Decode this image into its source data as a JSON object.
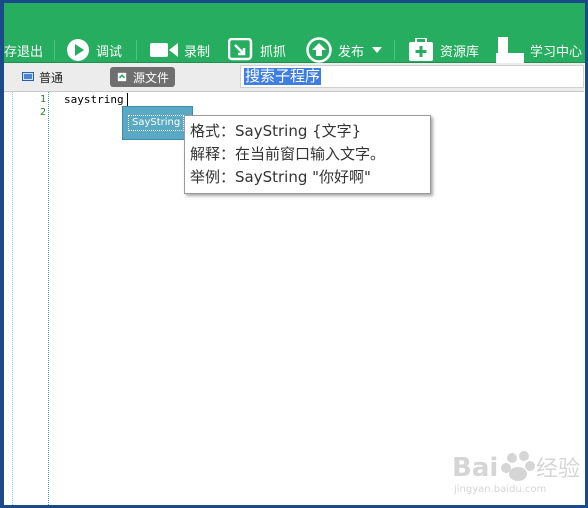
{
  "toolbar": {
    "items": [
      {
        "label": "存退出",
        "icon": "save-exit-icon"
      },
      {
        "label": "调试",
        "icon": "play-icon"
      },
      {
        "label": "录制",
        "icon": "video-camera-icon"
      },
      {
        "label": "抓抓",
        "icon": "capture-icon"
      },
      {
        "label": "发布",
        "icon": "publish-icon"
      },
      {
        "label": "资源库",
        "icon": "resource-box-icon"
      },
      {
        "label": "学习中心",
        "icon": "learning-center-icon"
      }
    ],
    "color": "#27ad60"
  },
  "tabs": {
    "normal": "普通",
    "source": "源文件"
  },
  "search": {
    "value": "搜索子程序"
  },
  "editor": {
    "line_numbers": [
      "1",
      "2"
    ],
    "code_line_1": "saystring"
  },
  "autocomplete": {
    "item": "SayString"
  },
  "tooltip": {
    "format": "格式：SayString {文字}",
    "explain": "解释：在当前窗口输入文字。",
    "example": "举例：SayString \"你好啊\""
  },
  "watermark": {
    "logo": "Baidu 经验",
    "url": "jingyan.baidu.com"
  }
}
